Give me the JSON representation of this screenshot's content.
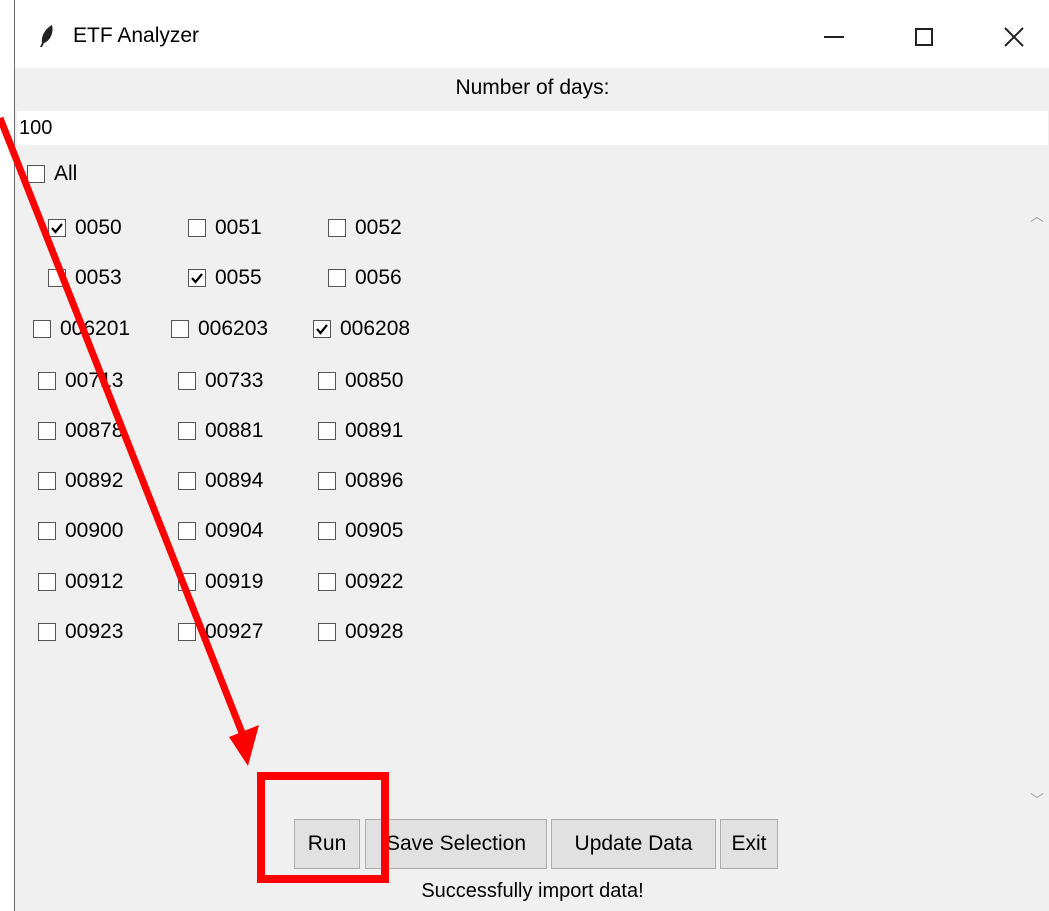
{
  "window": {
    "title": "ETF Analyzer"
  },
  "days": {
    "label": "Number of days:",
    "value": "100"
  },
  "all_checkbox": {
    "label": "All",
    "checked": false
  },
  "etfs": [
    {
      "label": "0050",
      "checked": true
    },
    {
      "label": "0051",
      "checked": false
    },
    {
      "label": "0052",
      "checked": false
    },
    {
      "label": "0053",
      "checked": false
    },
    {
      "label": "0055",
      "checked": true
    },
    {
      "label": "0056",
      "checked": false
    },
    {
      "label": "006201",
      "checked": false
    },
    {
      "label": "006203",
      "checked": false
    },
    {
      "label": "006208",
      "checked": true
    },
    {
      "label": "00713",
      "checked": false
    },
    {
      "label": "00733",
      "checked": false
    },
    {
      "label": "00850",
      "checked": false
    },
    {
      "label": "00878",
      "checked": false
    },
    {
      "label": "00881",
      "checked": false
    },
    {
      "label": "00891",
      "checked": false
    },
    {
      "label": "00892",
      "checked": false
    },
    {
      "label": "00894",
      "checked": false
    },
    {
      "label": "00896",
      "checked": false
    },
    {
      "label": "00900",
      "checked": false
    },
    {
      "label": "00904",
      "checked": false
    },
    {
      "label": "00905",
      "checked": false
    },
    {
      "label": "00912",
      "checked": false
    },
    {
      "label": "00919",
      "checked": false
    },
    {
      "label": "00922",
      "checked": false
    },
    {
      "label": "00923",
      "checked": false
    },
    {
      "label": "00927",
      "checked": false
    },
    {
      "label": "00928",
      "checked": false
    }
  ],
  "buttons": {
    "run": "Run",
    "save": "Save Selection",
    "update": "Update Data",
    "exit": "Exit"
  },
  "status": "Successfully import data!",
  "colors": {
    "annotation": "#ff0000",
    "window_bg": "#f0f0f0",
    "button_bg": "#e1e1e1"
  },
  "icons": {
    "app": "feather-icon",
    "minimize": "minimize-icon",
    "maximize": "maximize-icon",
    "close": "close-icon"
  }
}
